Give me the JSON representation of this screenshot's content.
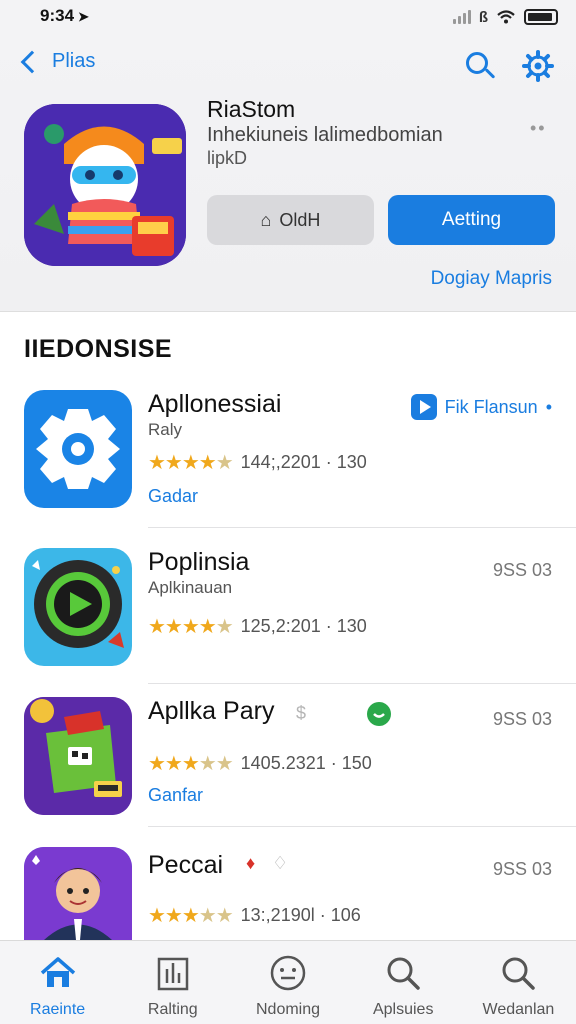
{
  "status": {
    "time": "9:34",
    "carrier": "ß"
  },
  "header": {
    "back_label": "Plias",
    "app_title": "RiaStom",
    "app_subtitle": "Inhekiuneis lalimedbomian",
    "app_meta": "lipkD",
    "open_label": "OldH",
    "get_label": "Aetting",
    "link_label": "Dogiay Mapris",
    "more": "••"
  },
  "section": {
    "title": "IIEDONSISE"
  },
  "items": [
    {
      "name": "Apllonessiai",
      "category": "Raly",
      "rating": "144;,2201 · 130",
      "link": "Gadar",
      "action": "Fik Flansun",
      "action_suffix": "•",
      "icon": "gear-app-icon",
      "icon_bg": "#1a84e6"
    },
    {
      "name": "Poplinsia",
      "category": "Aplkinauan",
      "rating": "125,2:201 · 130",
      "size": "9SS 03",
      "icon": "play-app-icon",
      "icon_bg": "#3cb7e8"
    },
    {
      "name": "Apllka Pary",
      "rating": "1405.2321 · 150",
      "link": "Ganfar",
      "size": "9SS 03",
      "icon": "game-app-icon",
      "icon_bg": "#5b2aa8"
    },
    {
      "name": "Peccai",
      "rating": "13:,2190l · 106",
      "size": "9SS 03",
      "icon": "avatar-app-icon",
      "icon_bg": "#4a6ad8"
    }
  ],
  "tabs": [
    {
      "label": "Raeinte",
      "icon": "home-icon"
    },
    {
      "label": "Ralting",
      "icon": "ratings-icon"
    },
    {
      "label": "Ndoming",
      "icon": "face-icon"
    },
    {
      "label": "Aplsuies",
      "icon": "search-icon"
    },
    {
      "label": "Wedanlan",
      "icon": "search-icon"
    }
  ],
  "colors": {
    "accent": "#1a7de0",
    "star": "#f0a81c"
  }
}
